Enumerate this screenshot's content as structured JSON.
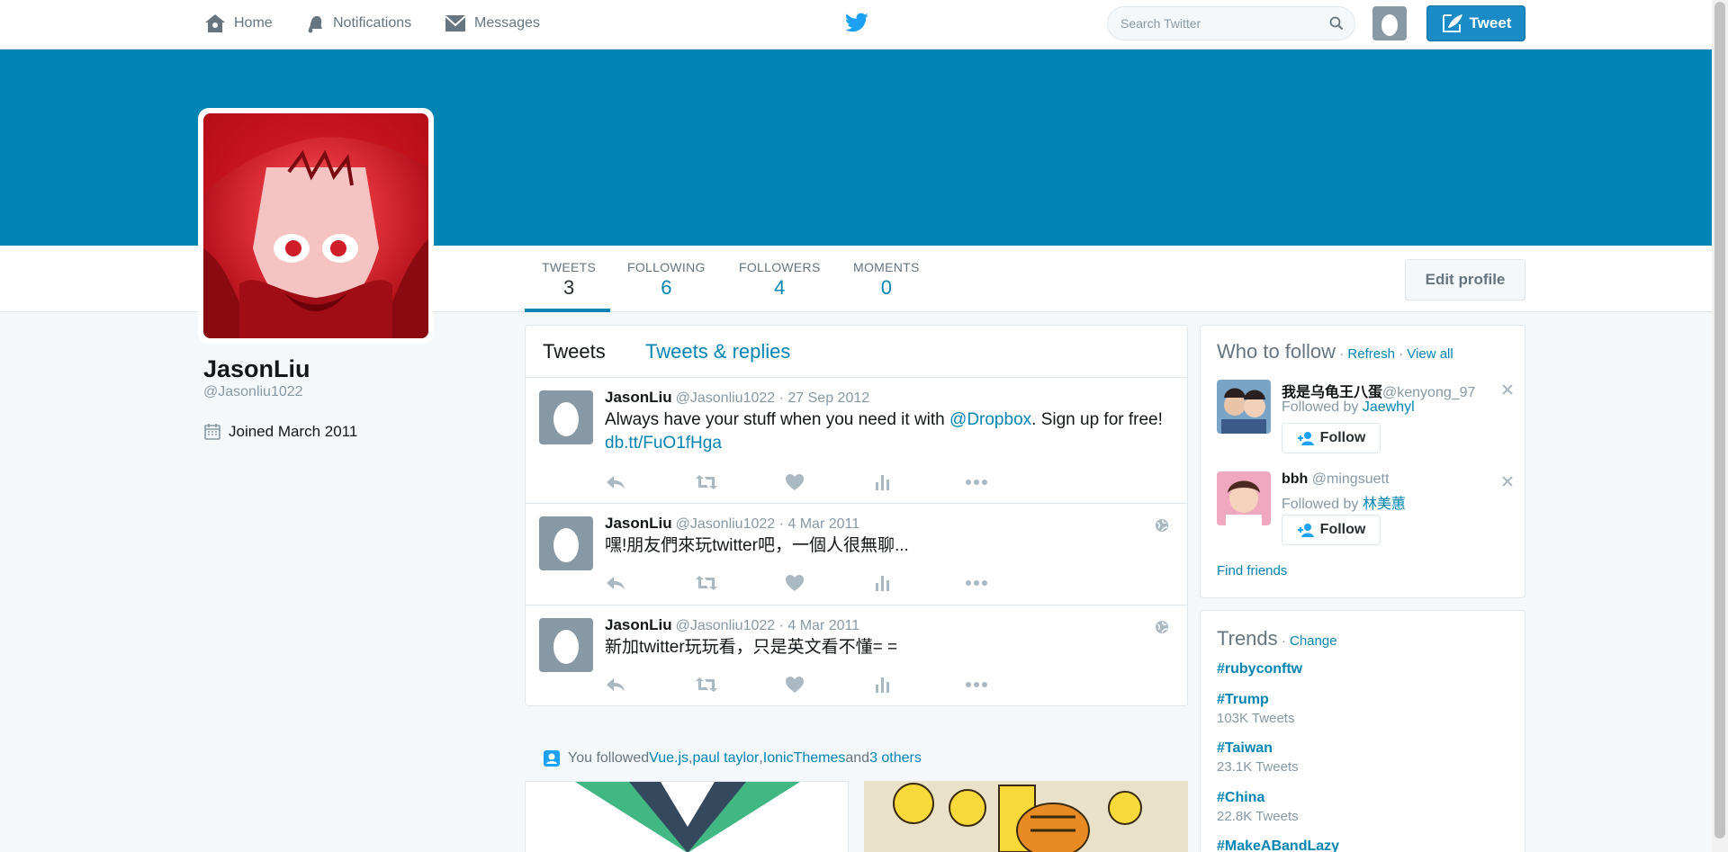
{
  "nav": {
    "home": "Home",
    "notifications": "Notifications",
    "messages": "Messages",
    "search_placeholder": "Search Twitter",
    "tweet_button": "Tweet"
  },
  "profile": {
    "name": "JasonLiu",
    "handle": "@Jasonliu1022",
    "joined": "Joined March 2011",
    "edit_button": "Edit profile"
  },
  "stats": [
    {
      "label": "TWEETS",
      "value": "3"
    },
    {
      "label": "FOLLOWING",
      "value": "6"
    },
    {
      "label": "FOLLOWERS",
      "value": "4"
    },
    {
      "label": "MOMENTS",
      "value": "0"
    }
  ],
  "timeline": {
    "tabs": [
      "Tweets",
      "Tweets & replies"
    ],
    "tweets": [
      {
        "name": "JasonLiu",
        "meta": "@Jasonliu1022 · 27 Sep 2012",
        "text_before": "Always have your stuff when you need it with ",
        "mention": "@Dropbox",
        "text_after": ". Sign up for free! ",
        "link": "db.tt/FuO1fHga"
      },
      {
        "name": "JasonLiu",
        "meta": "@Jasonliu1022 · 4 Mar 2011",
        "text": "嘿!朋友們來玩twitter吧，一個人很無聊..."
      },
      {
        "name": "JasonLiu",
        "meta": "@Jasonliu1022 · 4 Mar 2011",
        "text": "新加twitter玩玩看，只是英文看不懂= ="
      }
    ]
  },
  "followed": {
    "prefix": "You followed ",
    "a": "Vue.js",
    "sep1": ", ",
    "b": "paul taylor",
    "sep2": ", ",
    "c": "IonicThemes",
    "and": " and ",
    "others": "3 others"
  },
  "who_to_follow": {
    "title": "Who to follow",
    "dot": " · ",
    "refresh": "Refresh",
    "view_all": "View all",
    "suggestions": [
      {
        "name": "我是乌龟王八蛋",
        "handle": "@kenyong_97",
        "followed_by_prefix": "Followed by ",
        "followed_by": "Jaewhyl",
        "follow": "Follow"
      },
      {
        "name": "bbh",
        "handle": "@mingsuett",
        "followed_by_prefix": "Followed by ",
        "followed_by": "林美蕙",
        "follow": "Follow"
      }
    ],
    "find_friends": "Find friends"
  },
  "trends": {
    "title": "Trends",
    "change": "Change",
    "items": [
      {
        "tag": "#rubyconftw",
        "count": ""
      },
      {
        "tag": "#Trump",
        "count": "103K Tweets"
      },
      {
        "tag": "#Taiwan",
        "count": "23.1K Tweets"
      },
      {
        "tag": "#China",
        "count": "22.8K Tweets"
      },
      {
        "tag": "#MakeABandLazy",
        "count": ""
      }
    ]
  },
  "colors": {
    "brand": "#0084b4",
    "tweet_button": "#1a8bc7",
    "banner": "#0084b4"
  }
}
